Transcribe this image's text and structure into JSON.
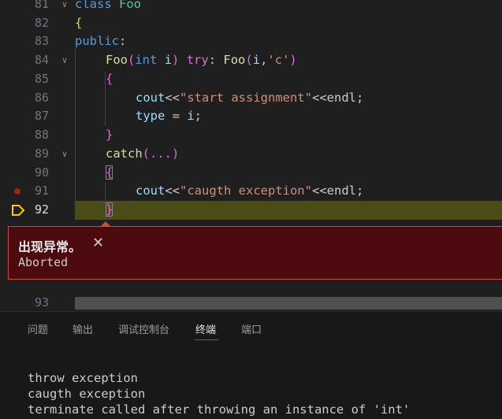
{
  "colors": {
    "highlight": "#4b4b18",
    "exception_bg": "#4c0a0e",
    "exception_border": "#c74e39",
    "breakpoint": "#a1260d",
    "current_line_marker": "#ffcc00"
  },
  "editor": {
    "line_numbers": [
      "81",
      "82",
      "83",
      "84",
      "85",
      "86",
      "87",
      "88",
      "89",
      "90",
      "91",
      "92",
      "93"
    ],
    "lines": {
      "l81": {
        "kw": "class",
        "sp": " ",
        "cls": "Foo"
      },
      "l82": {
        "b": "{"
      },
      "l83": {
        "kw": "public",
        "rest": ":"
      },
      "l84": {
        "fn1": "Foo",
        "p1": "(",
        "kw": "int",
        "sp": " ",
        "var": "i",
        "p2": ")",
        "sp2": " ",
        "kw2": "try",
        "c": ": ",
        "fn2": "Foo",
        "p3": "(",
        "var2": "i",
        "comma": ",",
        "str": "'c'",
        "p4": ")"
      },
      "l85": {
        "b": "{"
      },
      "l86": {
        "var": "cout",
        "op": "<<",
        "str": "\"start assignment\"",
        "op2": "<<",
        "fn": "endl",
        "semi": ";"
      },
      "l87": {
        "var": "type",
        "op": " = ",
        "var2": "i",
        "semi": ";"
      },
      "l88": {
        "b": "}"
      },
      "l89": {
        "kw": "catch",
        "p": "(...)"
      },
      "l90": {
        "b": "{"
      },
      "l91": {
        "var": "cout",
        "op": "<<",
        "str": "\"caugth exception\"",
        "op2": "<<",
        "fn": "endl",
        "semi": ";"
      },
      "l92": {
        "b": "}"
      }
    }
  },
  "exception": {
    "title": "出现异常。",
    "close": "✕",
    "message": "Aborted"
  },
  "panel": {
    "tabs": [
      "问题",
      "输出",
      "调试控制台",
      "终端",
      "端口"
    ],
    "active_tab": "终端",
    "terminal_lines": [
      "throw exception",
      "caugth exception",
      "terminate called after throwing an instance of 'int'"
    ]
  }
}
